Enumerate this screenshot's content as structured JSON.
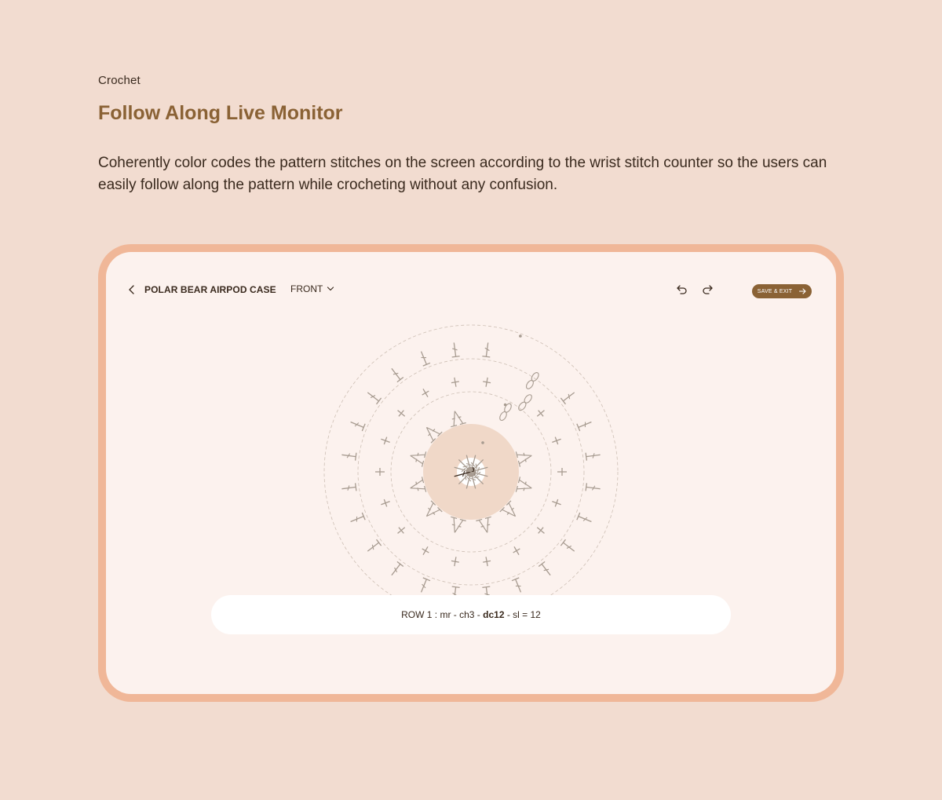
{
  "category": "Crochet",
  "headline": "Follow Along Live Monitor",
  "description": "Coherently color codes the pattern stitches on the screen according to the wrist stitch counter so the users can easily follow along the pattern while crocheting without any confusion.",
  "app": {
    "project_title": "POLAR BEAR AIRPOD CASE",
    "view_select": "FRONT",
    "save_exit_label": "SAVE & EXIT",
    "row_instruction": {
      "prefix": "ROW 1 : mr - ch3 - ",
      "current_stitch": "dc12",
      "suffix": " - sl = 12"
    }
  },
  "colors": {
    "page_background": "#f2dcd0",
    "accent": "#8a6235",
    "device_frame": "#f0b798",
    "screen_background": "#fcf2ee",
    "center_disc": "#f0d8c8",
    "stitch_symbol": "#a79b90",
    "active_stitch": "#3a2a1e"
  },
  "icons": [
    "chevron-left-icon",
    "chevron-down-icon",
    "undo-icon",
    "redo-icon",
    "arrow-right-icon"
  ]
}
